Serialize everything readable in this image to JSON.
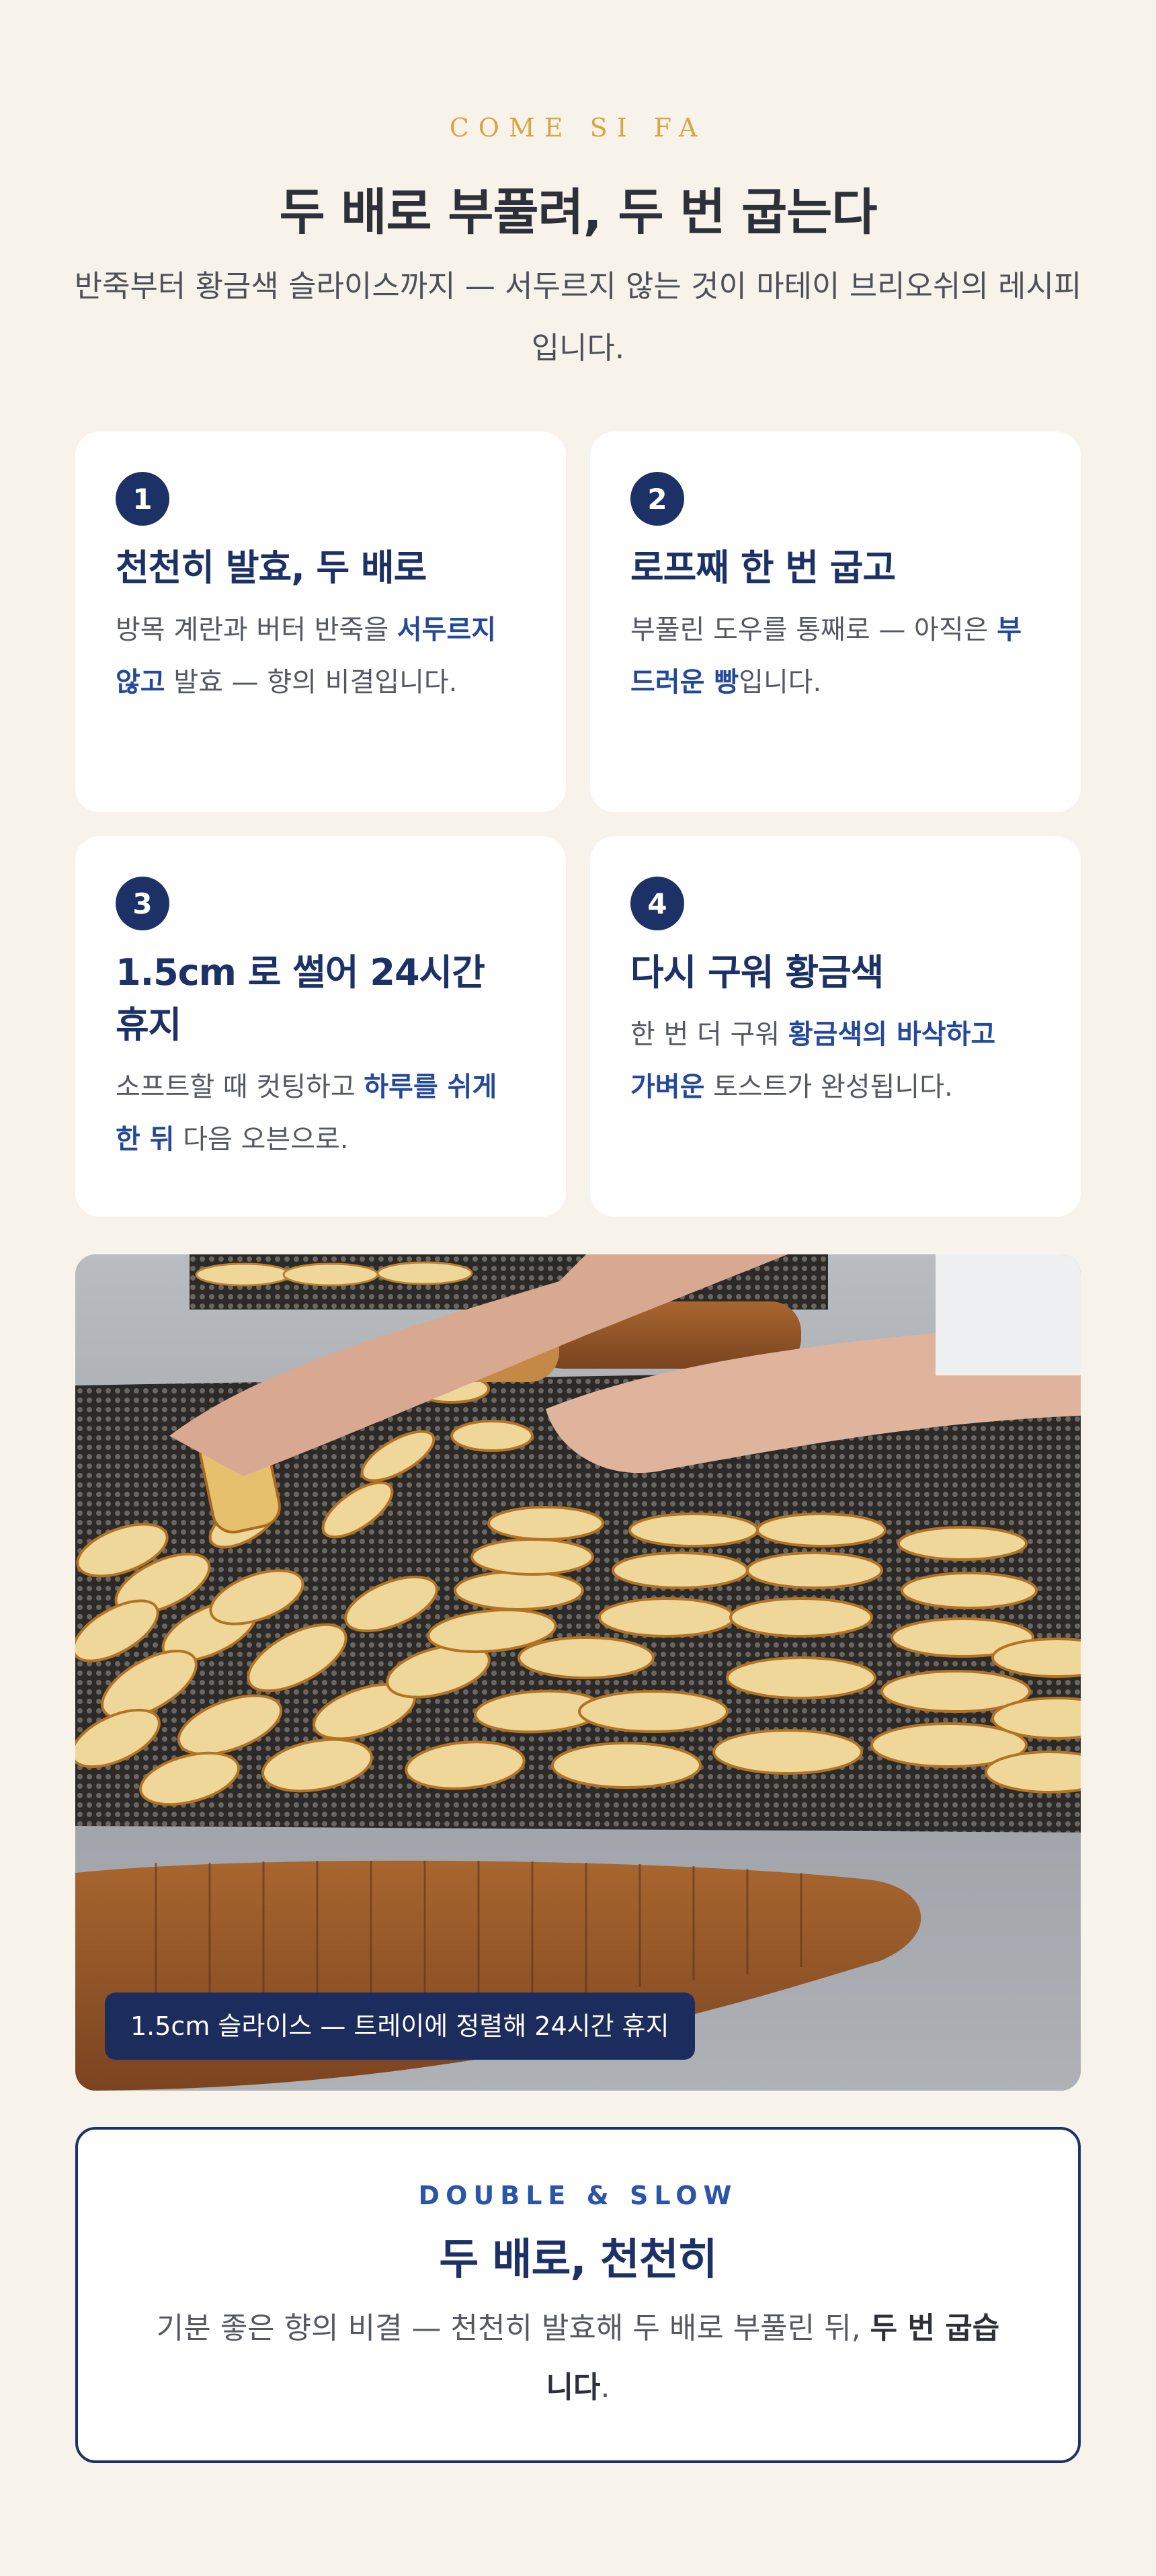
{
  "header": {
    "eyebrow": "COME SI FA",
    "title": "두 배로 부풀려, 두 번 굽는다",
    "lead": "반죽부터 황금색 슬라이스까지 — 서두르지 않는 것이 마테이 브리오쉬의 레시피입니다."
  },
  "steps": [
    {
      "number": "1",
      "title": "천천히 발효, 두 배로",
      "text_before": "방목 계란과 버터 반죽을 ",
      "highlight": "서두르지 않고",
      "text_after": " 발효 — 향의 비결입니다."
    },
    {
      "number": "2",
      "title": "로프째 한 번 굽고",
      "text_before": "부풀린 도우를 통째로 — 아직은 ",
      "highlight": "부드러운 빵",
      "text_after": "입니다."
    },
    {
      "number": "3",
      "title": "1.5cm 로 썰어 24시간 휴지",
      "text_before": "소프트할 때 컷팅하고 ",
      "highlight": "하루를 쉬게 한 뒤",
      "text_after": " 다음 오븐으로."
    },
    {
      "number": "4",
      "title": "다시 구워 황금색",
      "text_before": "한 번 더 구워 ",
      "highlight": "황금색의 바삭하고 가벼운",
      "text_after": " 토스트가 완성됩니다."
    }
  ],
  "photo": {
    "caption": "1.5cm 슬라이스 — 트레이에 정렬해 24시간 휴지"
  },
  "summary": {
    "eyebrow": "DOUBLE & SLOW",
    "title": "두 배로, 천천히",
    "text_before": "기분 좋은 향의 비결 — 천천히 발효해 두 배로 부풀린 뒤, ",
    "strong": "두 번 굽습니다",
    "text_after": "."
  },
  "colors": {
    "background": "#f8f3ea",
    "navy": "#1c3166",
    "gold": "#d9a441",
    "highlight_blue": "#24489a"
  }
}
